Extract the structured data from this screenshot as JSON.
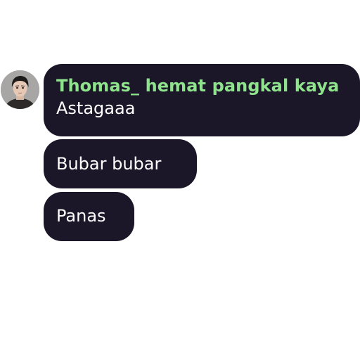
{
  "chat": {
    "sender_name": "Thomas_ hemat pangkal kaya",
    "messages": [
      {
        "text": "Astagaaa"
      },
      {
        "text": "Bubar bubar"
      },
      {
        "text": "Panas"
      }
    ]
  },
  "colors": {
    "bubble_bg": "#1b1728",
    "sender_name": "#8ee38c",
    "message_text": "#ffffff",
    "page_bg": "#ffffff"
  },
  "icons": {
    "avatar": "user-avatar"
  }
}
